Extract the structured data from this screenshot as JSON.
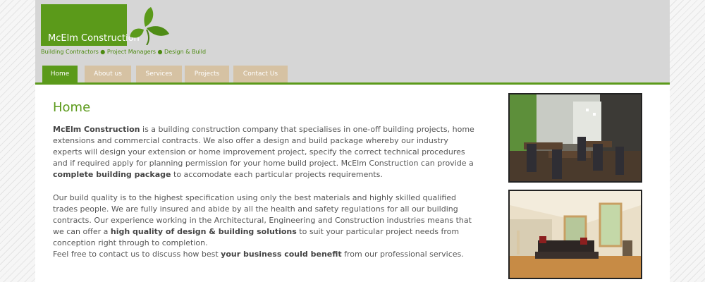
{
  "site": {
    "name": "McElm Construction",
    "tagline": "Building Contractors ● Project Managers ● Design & Build"
  },
  "nav": [
    {
      "label": "Home",
      "active": true
    },
    {
      "label": "About us",
      "active": false
    },
    {
      "label": "Services",
      "active": false
    },
    {
      "label": "Projects",
      "active": false
    },
    {
      "label": "Contact Us",
      "active": false
    }
  ],
  "main": {
    "title": "Home",
    "p1": {
      "b1": "McElm Construction",
      "t1": " is a building construction company that specialises in one-off building projects, home extensions and commercial contracts. We also offer a design and build package whereby our industry experts will design your extension or home improvement project, specify the correct technical procedures and if required apply for planning permission for your home build project. McElm Construction can provide a ",
      "b2": "complete building package",
      "t2": " to accomodate each particular projects requirements."
    },
    "p2": {
      "t1": "Our build quality is to the highest specification using only the best materials and highly skilled qualified trades people. We are fully insured and abide by all the health and safety regulations for all our building contracts. Our experience working in the Architectural, Engineering and Construction industries means that we can offer a ",
      "b1": "high quality of design & building solutions",
      "t2": " to suit your particular project needs from conception right through to completion."
    },
    "p3": {
      "t1": "Feel free to contact us to discuss how best ",
      "b1": "your business could benefit",
      "t2": " from our professional services."
    }
  },
  "colors": {
    "brand_green": "#5b9a1a",
    "tab_tan": "#d6c2a3",
    "header_grey": "#d6d6d6"
  },
  "icons": {
    "logo": "leaf-icon"
  }
}
